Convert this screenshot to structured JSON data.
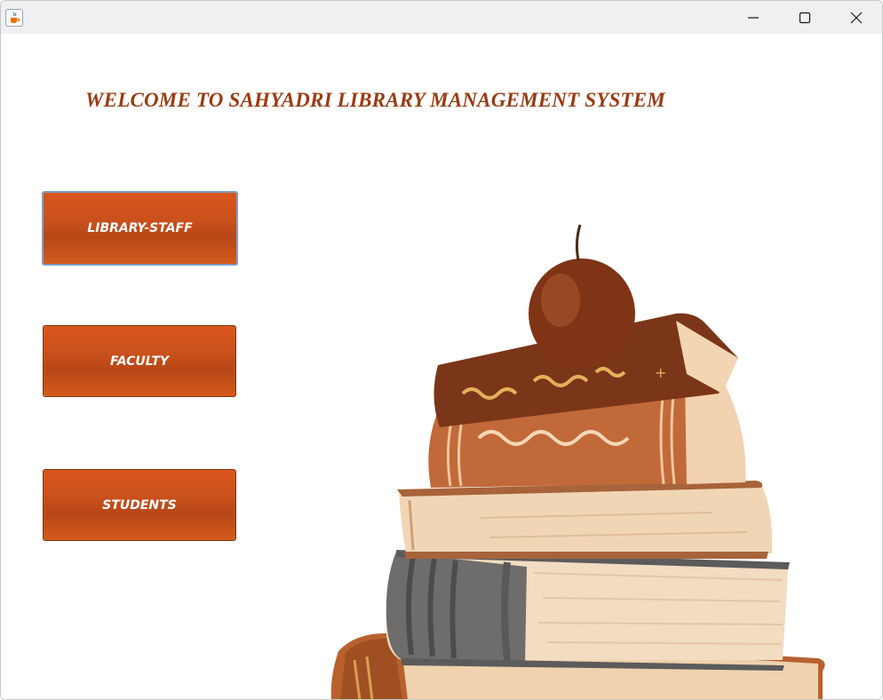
{
  "window": {
    "icon": "java-cup-icon",
    "controls": {
      "minimize": "minimize-icon",
      "maximize": "maximize-icon",
      "close": "close-icon"
    }
  },
  "main": {
    "title": "WELCOME TO SAHYADRI LIBRARY MANAGEMENT SYSTEM",
    "buttons": [
      {
        "label": "LIBRARY-STAFF"
      },
      {
        "label": "FACULTY"
      },
      {
        "label": "STUDENTS"
      }
    ],
    "image": "books-with-apple-illustration"
  },
  "colors": {
    "title": "#9a3b12",
    "button": "#c9501c",
    "focus_border": "#7f9fc7"
  }
}
